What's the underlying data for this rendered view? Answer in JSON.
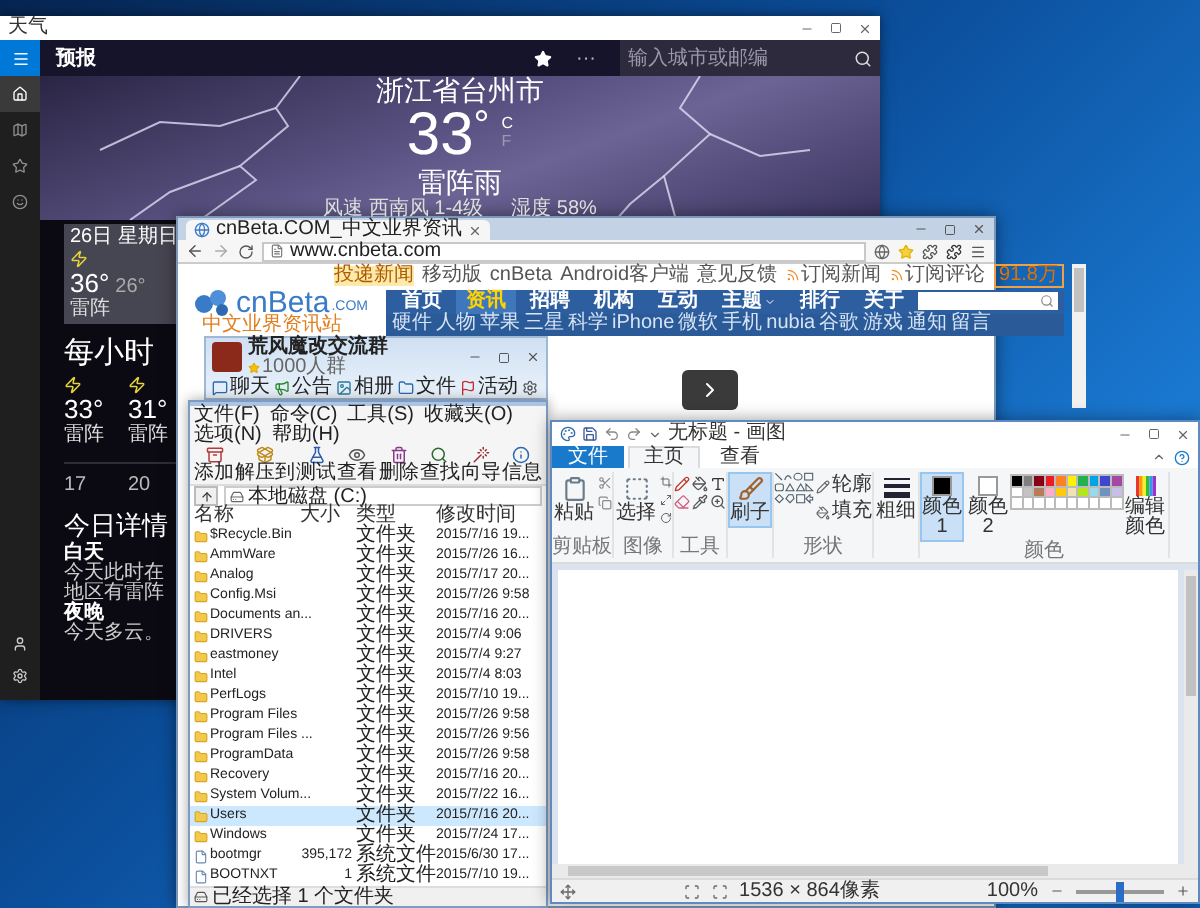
{
  "weather": {
    "title": "天气",
    "section": "预报",
    "more": "···",
    "search": {
      "placeholder": "输入城市或邮编"
    },
    "nav": [
      {
        "kind": "home",
        "selected": true
      },
      {
        "kind": "map",
        "selected": false
      },
      {
        "kind": "favorites",
        "selected": false
      },
      {
        "kind": "news",
        "selected": false
      }
    ],
    "city": "浙江省台州市",
    "temp": "33",
    "degree": "°",
    "units": [
      {
        "label": "C",
        "selected": true
      },
      {
        "label": "F",
        "selected": false
      }
    ],
    "condition": "雷阵雨",
    "details": [
      "风速 西南风 1-4级",
      "湿度 58%"
    ],
    "daily": [
      {
        "date": "26日 星期日",
        "high": "36°",
        "low": "26°",
        "summary": "雷阵"
      }
    ],
    "hourly_title": "每小时",
    "hourly": [
      {
        "temp": "33°",
        "summary": "雷阵",
        "time": "17"
      },
      {
        "temp": "31°",
        "summary": "雷阵",
        "time": "20"
      }
    ],
    "details_title": "今日详情",
    "today": [
      {
        "label": "白天",
        "text": "今天此时在地区有雷阵"
      },
      {
        "label": "夜晚",
        "text": "今天多云。"
      }
    ]
  },
  "browser": {
    "tab": "cnBeta.COM_中文业界资讯",
    "url": "www.cnbeta.com",
    "top_links": [
      {
        "text": "投递新闻",
        "kind": "highlight"
      },
      {
        "text": "移动版",
        "kind": "plain"
      },
      {
        "text": "cnBeta",
        "kind": "plain"
      },
      {
        "text": "Android客户端",
        "kind": "plain"
      },
      {
        "text": "意见反馈",
        "kind": "plain"
      },
      {
        "text": "订阅新闻",
        "kind": "rss"
      },
      {
        "text": "订阅评论",
        "kind": "rss"
      }
    ],
    "count": "91.8万",
    "logo": {
      "text": "cnBeta",
      "suffix": ".COM",
      "tagline": "中文业界资讯站"
    },
    "nav": [
      {
        "label": "首页",
        "selected": false,
        "dropdown": false
      },
      {
        "label": "资讯",
        "selected": true,
        "dropdown": false
      },
      {
        "label": "招聘",
        "selected": false,
        "dropdown": false
      },
      {
        "label": "机构",
        "selected": false,
        "dropdown": false
      },
      {
        "label": "互动",
        "selected": false,
        "dropdown": false
      },
      {
        "label": "主题",
        "selected": false,
        "dropdown": true
      },
      {
        "label": "排行",
        "selected": false,
        "dropdown": false
      },
      {
        "label": "关于",
        "selected": false,
        "dropdown": false
      }
    ],
    "subnav": [
      "硬件",
      "人物",
      "苹果",
      "三星",
      "科学",
      "iPhone",
      "微软",
      "手机",
      "nubia",
      "谷歌",
      "游戏",
      "通知",
      "留言"
    ]
  },
  "qq": {
    "name": "荒风魔改交流群",
    "members": "1000人群",
    "tools": [
      {
        "kind": "chat",
        "label": "聊天"
      },
      {
        "kind": "notice",
        "label": "公告"
      },
      {
        "kind": "album",
        "label": "相册"
      },
      {
        "kind": "files",
        "label": "文件"
      },
      {
        "kind": "events",
        "label": "活动"
      }
    ]
  },
  "archiver": {
    "menu": [
      "文件(F)",
      "命令(C)",
      "工具(S)",
      "收藏夹(O)",
      "选项(N)",
      "帮助(H)"
    ],
    "tools": [
      {
        "kind": "add",
        "label": "添加"
      },
      {
        "kind": "extract",
        "label": "解压到"
      },
      {
        "kind": "test",
        "label": "测试"
      },
      {
        "kind": "view",
        "label": "查看"
      },
      {
        "kind": "delete",
        "label": "删除"
      },
      {
        "kind": "find",
        "label": "查找"
      },
      {
        "kind": "wizard",
        "label": "向导"
      },
      {
        "kind": "info",
        "label": "信息"
      }
    ],
    "path": "本地磁盘 (C:)",
    "columns": [
      "名称",
      "大小",
      "类型",
      "修改时间"
    ],
    "rows": [
      {
        "kind": "folder",
        "name": "$Recycle.Bin",
        "size": "",
        "type": "文件夹",
        "modified": "2015/7/16 19...",
        "selected": false
      },
      {
        "kind": "folder",
        "name": "AmmWare",
        "size": "",
        "type": "文件夹",
        "modified": "2015/7/26 16...",
        "selected": false
      },
      {
        "kind": "folder",
        "name": "Analog",
        "size": "",
        "type": "文件夹",
        "modified": "2015/7/17 20...",
        "selected": false
      },
      {
        "kind": "folder",
        "name": "Config.Msi",
        "size": "",
        "type": "文件夹",
        "modified": "2015/7/26 9:58",
        "selected": false
      },
      {
        "kind": "folder",
        "name": "Documents an...",
        "size": "",
        "type": "文件夹",
        "modified": "2015/7/16 20...",
        "selected": false
      },
      {
        "kind": "folder",
        "name": "DRIVERS",
        "size": "",
        "type": "文件夹",
        "modified": "2015/7/4 9:06",
        "selected": false
      },
      {
        "kind": "folder",
        "name": "eastmoney",
        "size": "",
        "type": "文件夹",
        "modified": "2015/7/4 9:27",
        "selected": false
      },
      {
        "kind": "folder",
        "name": "Intel",
        "size": "",
        "type": "文件夹",
        "modified": "2015/7/4 8:03",
        "selected": false
      },
      {
        "kind": "folder",
        "name": "PerfLogs",
        "size": "",
        "type": "文件夹",
        "modified": "2015/7/10 19...",
        "selected": false
      },
      {
        "kind": "folder",
        "name": "Program Files",
        "size": "",
        "type": "文件夹",
        "modified": "2015/7/26 9:58",
        "selected": false
      },
      {
        "kind": "folder",
        "name": "Program Files ...",
        "size": "",
        "type": "文件夹",
        "modified": "2015/7/26 9:56",
        "selected": false
      },
      {
        "kind": "folder",
        "name": "ProgramData",
        "size": "",
        "type": "文件夹",
        "modified": "2015/7/26 9:58",
        "selected": false
      },
      {
        "kind": "folder",
        "name": "Recovery",
        "size": "",
        "type": "文件夹",
        "modified": "2015/7/16 20...",
        "selected": false
      },
      {
        "kind": "folder",
        "name": "System Volum...",
        "size": "",
        "type": "文件夹",
        "modified": "2015/7/22 16...",
        "selected": false
      },
      {
        "kind": "folder",
        "name": "Users",
        "size": "",
        "type": "文件夹",
        "modified": "2015/7/16 20...",
        "selected": true
      },
      {
        "kind": "folder",
        "name": "Windows",
        "size": "",
        "type": "文件夹",
        "modified": "2015/7/24 17...",
        "selected": false
      },
      {
        "kind": "file",
        "name": "bootmgr",
        "size": "395,172",
        "type": "系统文件",
        "modified": "2015/6/30 17...",
        "selected": false
      },
      {
        "kind": "file",
        "name": "BOOTNXT",
        "size": "1",
        "type": "系统文件",
        "modified": "2015/7/10 19...",
        "selected": false
      }
    ],
    "status": "已经选择 1 个文件夹"
  },
  "paint": {
    "title": "无标题 - 画图",
    "tabs": [
      {
        "label": "文件",
        "kind": "file",
        "selected": false
      },
      {
        "label": "主页",
        "kind": "tab",
        "selected": true
      },
      {
        "label": "查看",
        "kind": "tab",
        "selected": false
      }
    ],
    "groups": [
      "剪贴板",
      "图像",
      "工具",
      "形状",
      "颜色"
    ],
    "paste": "粘贴",
    "select": "选择",
    "brush": {
      "label": "刷子",
      "selected": true
    },
    "outline": "轮廓",
    "fill": "填充",
    "size": "粗细",
    "color1": {
      "label": "颜色 1",
      "color": "#000000",
      "selected": true
    },
    "color2": {
      "label": "颜色 2",
      "color": "#ffffff",
      "selected": false
    },
    "edit_colors": "编辑颜色",
    "palette": [
      {
        "color": "#000000"
      },
      {
        "color": "#7f7f7f"
      },
      {
        "color": "#880015"
      },
      {
        "color": "#ed1c24"
      },
      {
        "color": "#ff7f27"
      },
      {
        "color": "#fff200"
      },
      {
        "color": "#22b14c"
      },
      {
        "color": "#00a2e8"
      },
      {
        "color": "#3f48cc"
      },
      {
        "color": "#a349a4"
      },
      {
        "color": "#ffffff"
      },
      {
        "color": "#c3c3c3"
      },
      {
        "color": "#b97a57"
      },
      {
        "color": "#ffaec9"
      },
      {
        "color": "#ffc90e"
      },
      {
        "color": "#efe4b0"
      },
      {
        "color": "#b5e61d"
      },
      {
        "color": "#99d9ea"
      },
      {
        "color": "#7092be"
      },
      {
        "color": "#c8bfe7"
      }
    ],
    "status": {
      "size": "1536 × 864像素",
      "zoom": "100%",
      "zoom_slider": {
        "level": 0.5
      }
    }
  }
}
